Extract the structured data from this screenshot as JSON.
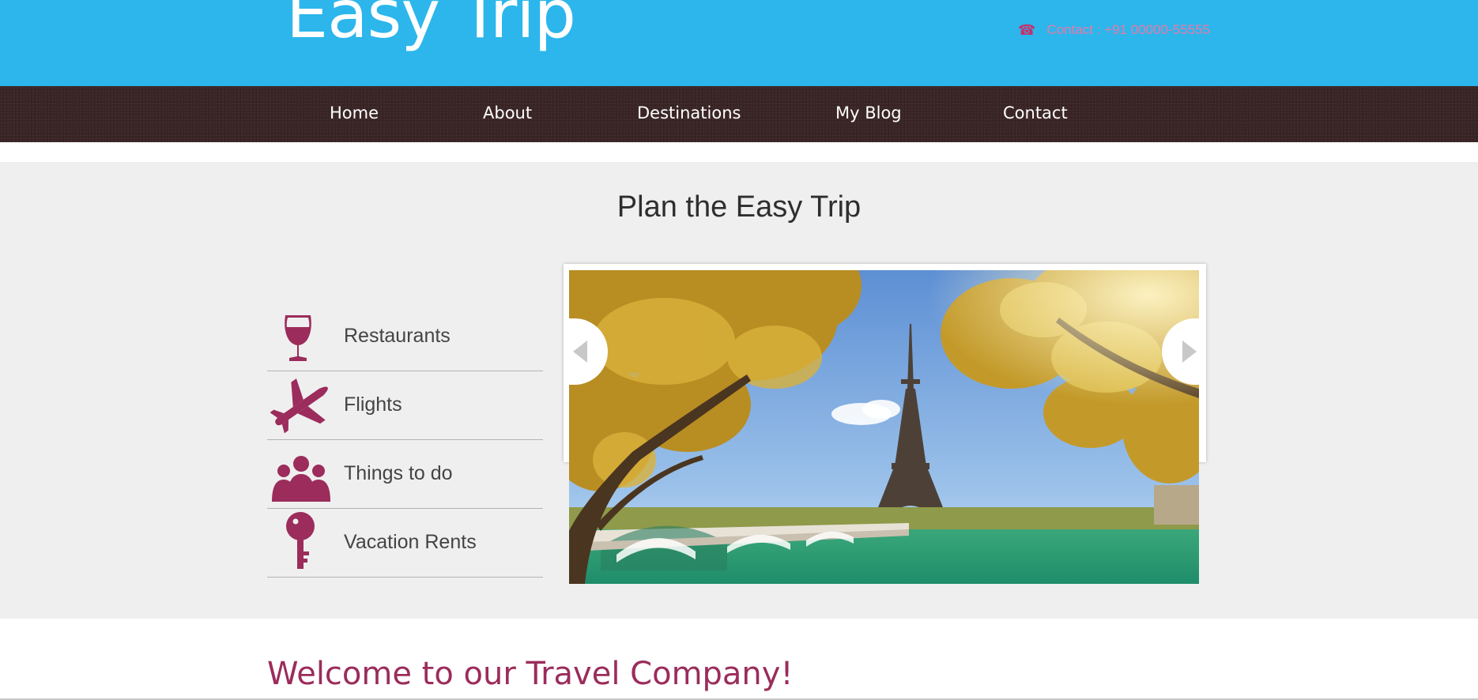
{
  "header": {
    "logo_text": "Easy Trip",
    "contact_icon": "phone-icon",
    "contact_text": "Contact : +91 00000-55555"
  },
  "nav": {
    "items": [
      {
        "label": "Home"
      },
      {
        "label": "About"
      },
      {
        "label": "Destinations"
      },
      {
        "label": "My Blog"
      },
      {
        "label": "Contact"
      }
    ]
  },
  "plan": {
    "title": "Plan the Easy Trip",
    "menu": [
      {
        "label": "Restaurants",
        "icon": "wine-glass-icon"
      },
      {
        "label": "Flights",
        "icon": "airplane-icon"
      },
      {
        "label": "Things to do",
        "icon": "people-icon"
      },
      {
        "label": "Vacation Rents",
        "icon": "key-icon"
      }
    ],
    "slider": {
      "image": "eiffel-tower-photo",
      "prev_icon": "arrow-left-icon",
      "next_icon": "arrow-right-icon"
    }
  },
  "welcome": {
    "heading": "Welcome to our Travel Company!"
  },
  "colors": {
    "header_blue": "#2cb6ec",
    "nav_brown": "#3a2526",
    "accent_magenta": "#9b2c5b",
    "contact_pink": "#e87aa6",
    "section_gray": "#efefef"
  }
}
